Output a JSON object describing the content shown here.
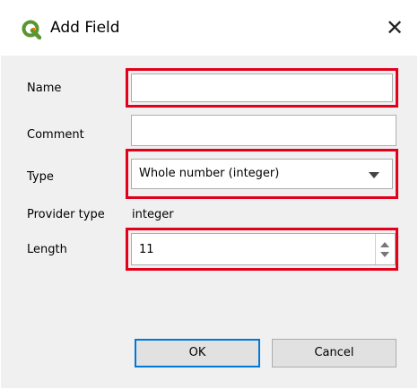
{
  "dialog": {
    "title": "Add Field",
    "close_glyph": "✕",
    "app_icon": "qgis-logo-icon"
  },
  "form": {
    "name_label": "Name",
    "name_value": "",
    "comment_label": "Comment",
    "comment_value": "",
    "type_label": "Type",
    "type_value": "Whole number (integer)",
    "provider_type_label": "Provider type",
    "provider_type_value": "integer",
    "length_label": "Length",
    "length_value": "11"
  },
  "buttons": {
    "ok_label": "OK",
    "cancel_label": "Cancel"
  },
  "colors": {
    "highlight": "#e3001b",
    "qgis_green": "#589632",
    "qgis_yellow": "#ee7913"
  }
}
